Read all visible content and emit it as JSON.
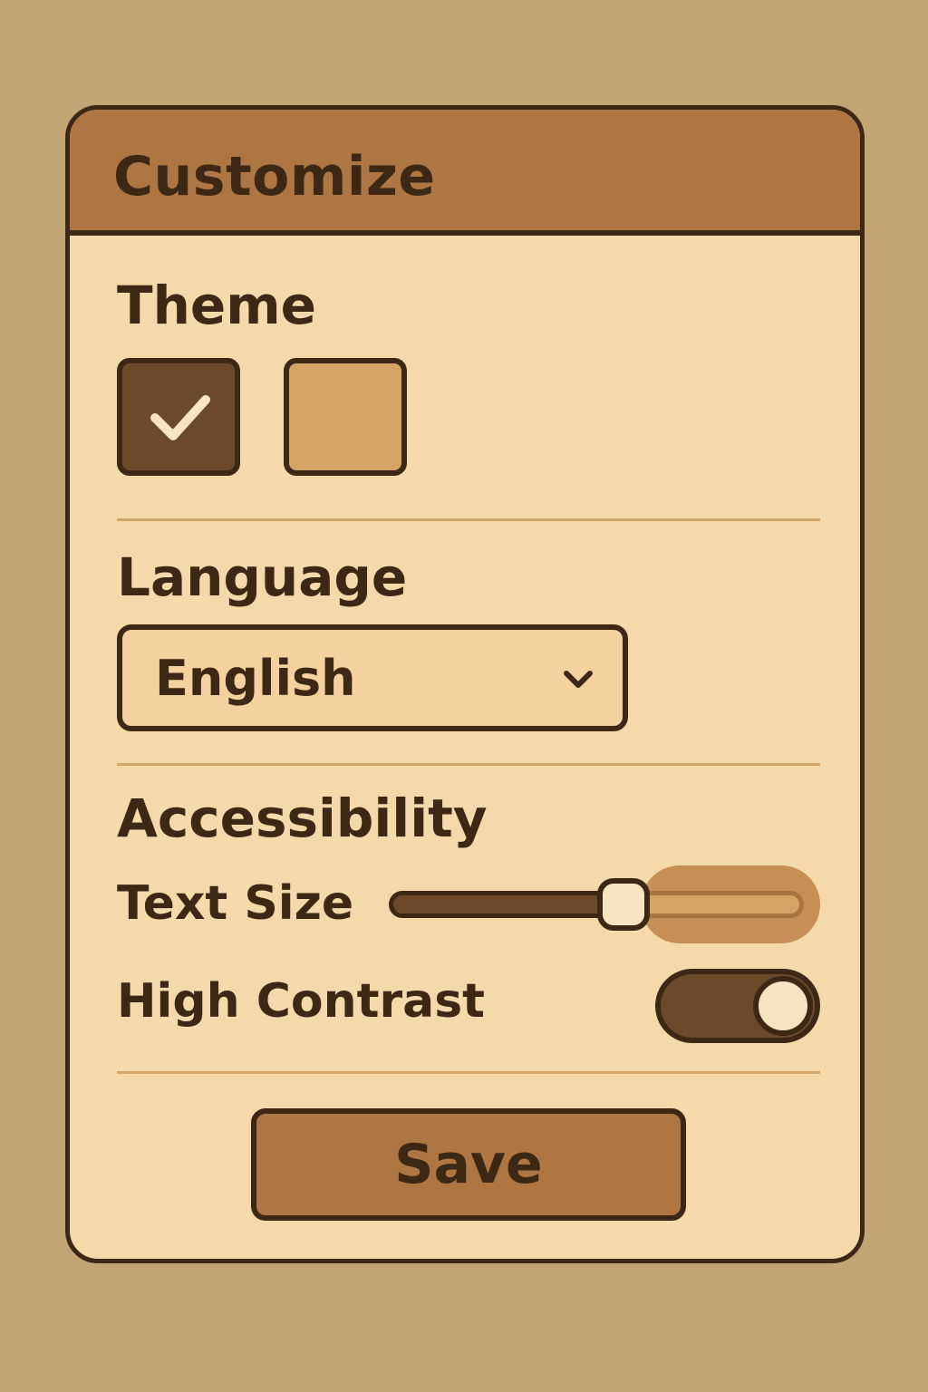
{
  "header": {
    "title": "Customize"
  },
  "theme": {
    "title": "Theme",
    "options": [
      {
        "name": "dark",
        "color": "#6b4a2c",
        "selected": true
      },
      {
        "name": "light",
        "color": "#d4a465",
        "selected": false
      }
    ]
  },
  "language": {
    "title": "Language",
    "selected": "English"
  },
  "accessibility": {
    "title": "Accessibility",
    "text_size": {
      "label": "Text Size",
      "value_fraction": 0.55
    },
    "high_contrast": {
      "label": "High Contrast",
      "on": true
    }
  },
  "actions": {
    "save_label": "Save"
  },
  "colors": {
    "background": "#c1a574",
    "panel": "#f4d9ab",
    "header": "#ad7643",
    "outline": "#3d2816",
    "accent_dark": "#6b4a2c",
    "divider": "#d3a76a"
  },
  "icons": {
    "selected_theme": "check-icon",
    "dropdown": "chevron-down-icon"
  }
}
